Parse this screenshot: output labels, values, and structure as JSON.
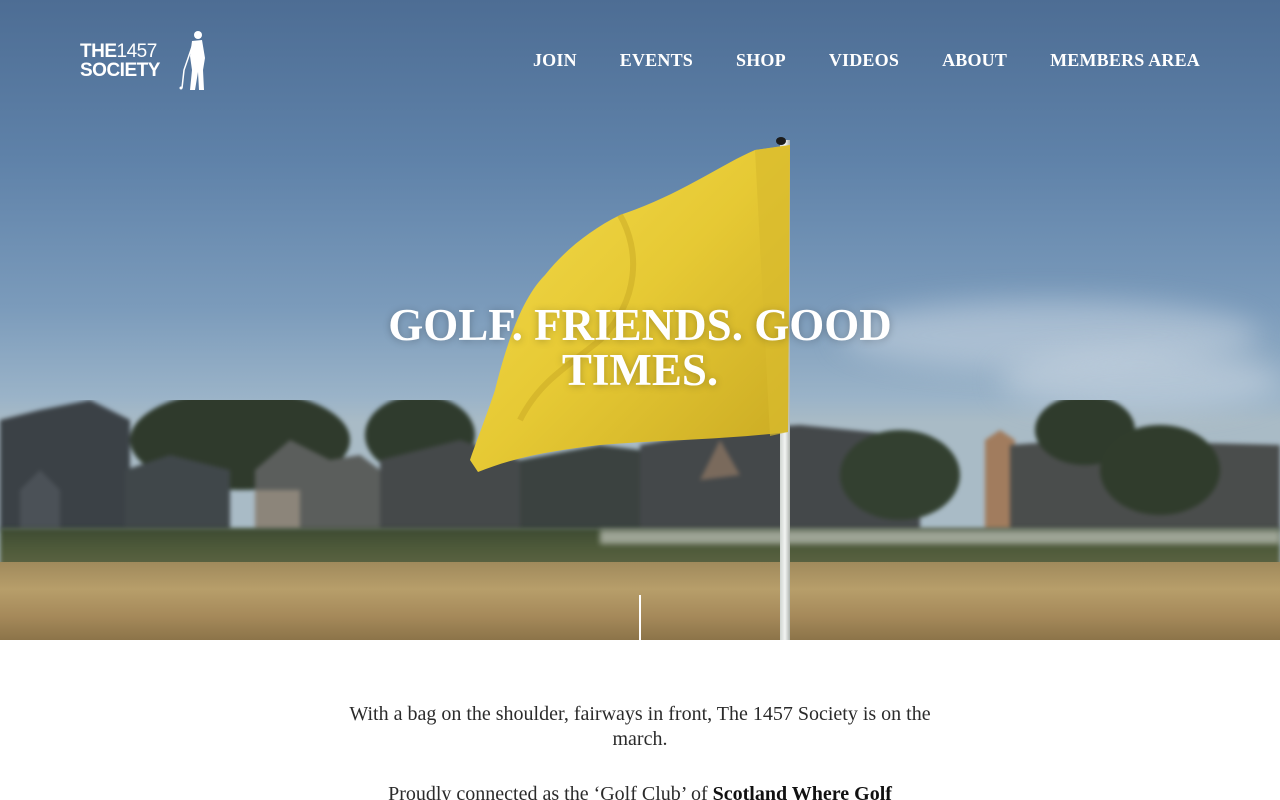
{
  "brand": {
    "logo_line1_word": "THE",
    "logo_line1_number": "1457",
    "logo_line2": "SOCIETY"
  },
  "nav": {
    "items": [
      {
        "label": "JOIN"
      },
      {
        "label": "EVENTS"
      },
      {
        "label": "SHOP"
      },
      {
        "label": "VIDEOS"
      },
      {
        "label": "ABOUT"
      },
      {
        "label": "MEMBERS AREA"
      }
    ]
  },
  "hero": {
    "headline": "GOLF. FRIENDS. GOOD TIMES.",
    "flag_color": "#e8cd3c"
  },
  "intro": {
    "paragraph1": "With a bag on the shoulder, fairways in front, The 1457 Society is on the march.",
    "paragraph2_prefix": "Proudly connected as the ‘Golf Club’ of ",
    "paragraph2_bold": "Scotland Where Golf"
  },
  "colors": {
    "nav_text": "#ffffff",
    "body_text": "#2b2b2b",
    "sky": "#5f82a9"
  }
}
